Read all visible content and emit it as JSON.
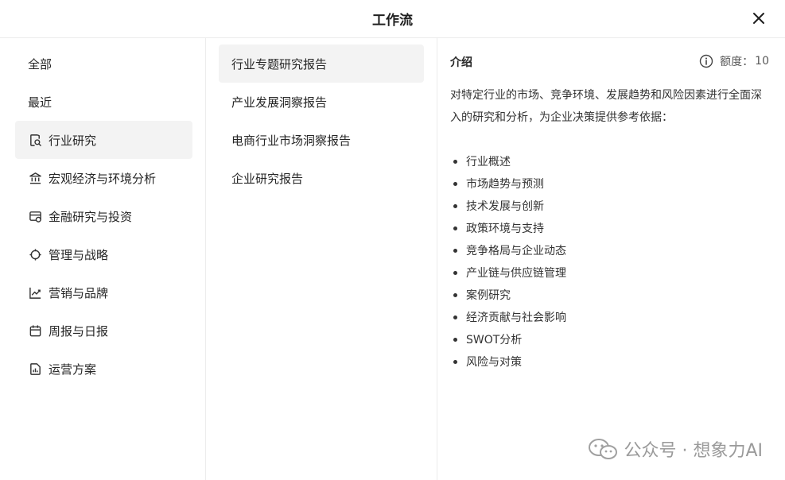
{
  "header": {
    "title": "工作流",
    "close_icon": "close-icon"
  },
  "categories": [
    {
      "label": "全部",
      "icon": null
    },
    {
      "label": "最近",
      "icon": null
    },
    {
      "label": "行业研究",
      "icon": "doc-search-icon",
      "active": true
    },
    {
      "label": "宏观经济与环境分析",
      "icon": "bank-icon"
    },
    {
      "label": "金融研究与投资",
      "icon": "finance-icon"
    },
    {
      "label": "管理与战略",
      "icon": "target-icon"
    },
    {
      "label": "营销与品牌",
      "icon": "chart-line-icon"
    },
    {
      "label": "周报与日报",
      "icon": "calendar-icon"
    },
    {
      "label": "运营方案",
      "icon": "report-icon"
    }
  ],
  "workflows": [
    {
      "label": "行业专题研究报告",
      "active": true
    },
    {
      "label": "产业发展洞察报告"
    },
    {
      "label": "电商行业市场洞察报告"
    },
    {
      "label": "企业研究报告"
    }
  ],
  "intro": {
    "title": "介绍",
    "quota_label": "额度：",
    "quota_value": "10",
    "description": "对特定行业的市场、竞争环境、发展趋势和风险因素进行全面深入的研究和分析，为企业决策提供参考依据：",
    "bullets": [
      "行业概述",
      "市场趋势与预测",
      "技术发展与创新",
      "政策环境与支持",
      "竞争格局与企业动态",
      "产业链与供应链管理",
      "案例研究",
      "经济贡献与社会影响",
      "SWOT分析",
      "风险与对策"
    ]
  },
  "watermark": {
    "text": "公众号 · 想象力AI"
  },
  "colors": {
    "active_bg": "#f3f3f3",
    "border": "#ececec",
    "text": "#262626"
  }
}
